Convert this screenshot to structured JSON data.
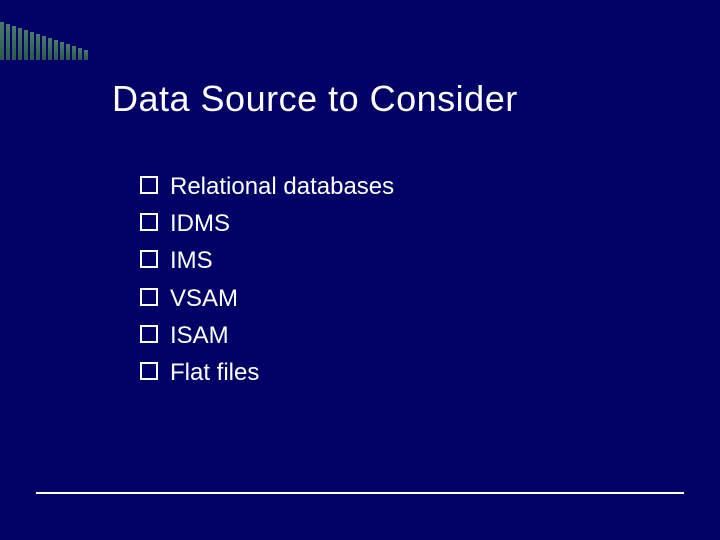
{
  "slide": {
    "title": "Data Source to Consider",
    "bullets": [
      "Relational databases",
      "IDMS",
      "IMS",
      "VSAM",
      "ISAM",
      "Flat files"
    ]
  }
}
